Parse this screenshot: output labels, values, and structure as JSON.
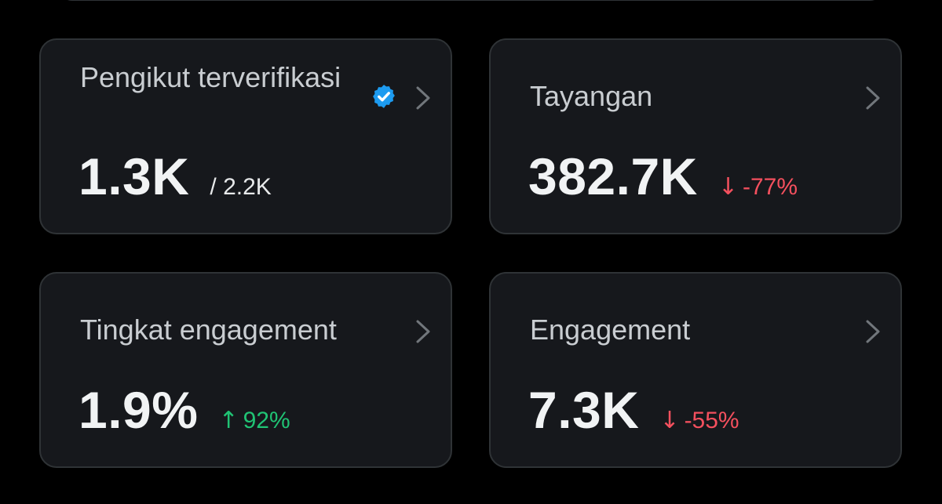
{
  "colors": {
    "background": "#000000",
    "card": "#16181c",
    "border": "#2f3336",
    "verified": "#1d9bf0",
    "negative": "#f4505e",
    "positive": "#20c374"
  },
  "cards": [
    {
      "label": "Pengikut terverifikasi",
      "value": "1.3K",
      "secondary": "/ 2.2K",
      "icon": "verified-badge-icon"
    },
    {
      "label": "Tayangan",
      "value": "382.7K",
      "delta_arrow": "↓",
      "delta": "-77%",
      "trend": "down"
    },
    {
      "label": "Tingkat engagement",
      "value": "1.9%",
      "delta_arrow": "↑",
      "delta": "92%",
      "trend": "up"
    },
    {
      "label": "Engagement",
      "value": "7.3K",
      "delta_arrow": "↓",
      "delta": "-55%",
      "trend": "down"
    }
  ]
}
